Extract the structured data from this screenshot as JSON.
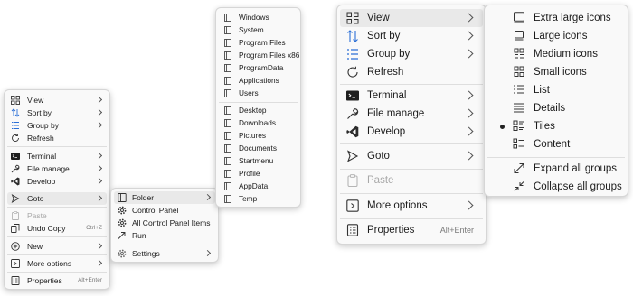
{
  "small_context_menu": {
    "items": [
      {
        "label": "View",
        "icon": "view-grid-icon",
        "submenu": true
      },
      {
        "label": "Sort by",
        "icon": "sort-icon",
        "submenu": true
      },
      {
        "label": "Group by",
        "icon": "group-list-icon",
        "submenu": true
      },
      {
        "label": "Refresh",
        "icon": "refresh-icon"
      },
      {
        "label": "Terminal",
        "icon": "terminal-icon",
        "submenu": true
      },
      {
        "label": "File manage",
        "icon": "wrench-icon",
        "submenu": true
      },
      {
        "label": "Develop",
        "icon": "vscode-icon",
        "submenu": true
      },
      {
        "label": "Goto",
        "icon": "goto-arrow-icon",
        "submenu": true
      },
      {
        "label": "Paste",
        "icon": "paste-icon",
        "disabled": true
      },
      {
        "label": "Undo Copy",
        "icon": "undo-icon",
        "shortcut": "Ctrl+Z"
      },
      {
        "label": "New",
        "icon": "new-plus-icon",
        "submenu": true
      },
      {
        "label": "More options",
        "icon": "more-options-icon",
        "submenu": true
      },
      {
        "label": "Properties",
        "icon": "properties-icon",
        "shortcut": "Alt+Enter"
      }
    ]
  },
  "goto_submenu": {
    "items": [
      {
        "label": "Folder",
        "icon": "folder-icon",
        "submenu": true
      },
      {
        "label": "Control Panel",
        "icon": "gear-icon"
      },
      {
        "label": "All Control Panel Items",
        "icon": "gear-icon"
      },
      {
        "label": "Run",
        "icon": "run-arrow-icon"
      },
      {
        "label": "Settings",
        "icon": "settings-gear-icon",
        "submenu": true
      }
    ]
  },
  "folder_submenu": {
    "items": [
      "Windows",
      "System",
      "Program Files",
      "Program Files x86",
      "ProgramData",
      "Applications",
      "Users",
      "Desktop",
      "Downloads",
      "Pictures",
      "Documents",
      "Startmenu",
      "Profile",
      "AppData",
      "Temp"
    ]
  },
  "large_context_menu": {
    "items": [
      {
        "label": "View",
        "icon": "view-grid-icon",
        "submenu": true
      },
      {
        "label": "Sort by",
        "icon": "sort-icon",
        "submenu": true
      },
      {
        "label": "Group by",
        "icon": "group-list-icon",
        "submenu": true
      },
      {
        "label": "Refresh",
        "icon": "refresh-icon"
      },
      {
        "label": "Terminal",
        "icon": "terminal-icon",
        "submenu": true
      },
      {
        "label": "File manage",
        "icon": "wrench-icon",
        "submenu": true
      },
      {
        "label": "Develop",
        "icon": "vscode-icon",
        "submenu": true
      },
      {
        "label": "Goto",
        "icon": "goto-arrow-icon",
        "submenu": true
      },
      {
        "label": "Paste",
        "icon": "paste-icon",
        "disabled": true
      },
      {
        "label": "More options",
        "icon": "more-options-icon",
        "submenu": true
      },
      {
        "label": "Properties",
        "icon": "properties-icon",
        "shortcut": "Alt+Enter"
      }
    ]
  },
  "view_submenu": {
    "items": [
      {
        "label": "Extra large icons",
        "icon": "extra-large-icons-icon"
      },
      {
        "label": "Large icons",
        "icon": "large-icons-icon"
      },
      {
        "label": "Medium icons",
        "icon": "medium-icons-icon"
      },
      {
        "label": "Small icons",
        "icon": "small-icons-icon"
      },
      {
        "label": "List",
        "icon": "list-icon"
      },
      {
        "label": "Details",
        "icon": "details-icon"
      },
      {
        "label": "Tiles",
        "icon": "tiles-icon",
        "selected": true
      },
      {
        "label": "Content",
        "icon": "content-icon"
      },
      {
        "label": "Expand all groups",
        "icon": "expand-icon"
      },
      {
        "label": "Collapse all groups",
        "icon": "collapse-icon"
      }
    ]
  },
  "colors": {
    "menu_bg": "#f9f9f9",
    "highlight": "#e9e9e9",
    "disabled_text": "#a8a8a8",
    "terminal_icon": "#1f1f1f",
    "vscode_icon": "#2b2b2b"
  }
}
